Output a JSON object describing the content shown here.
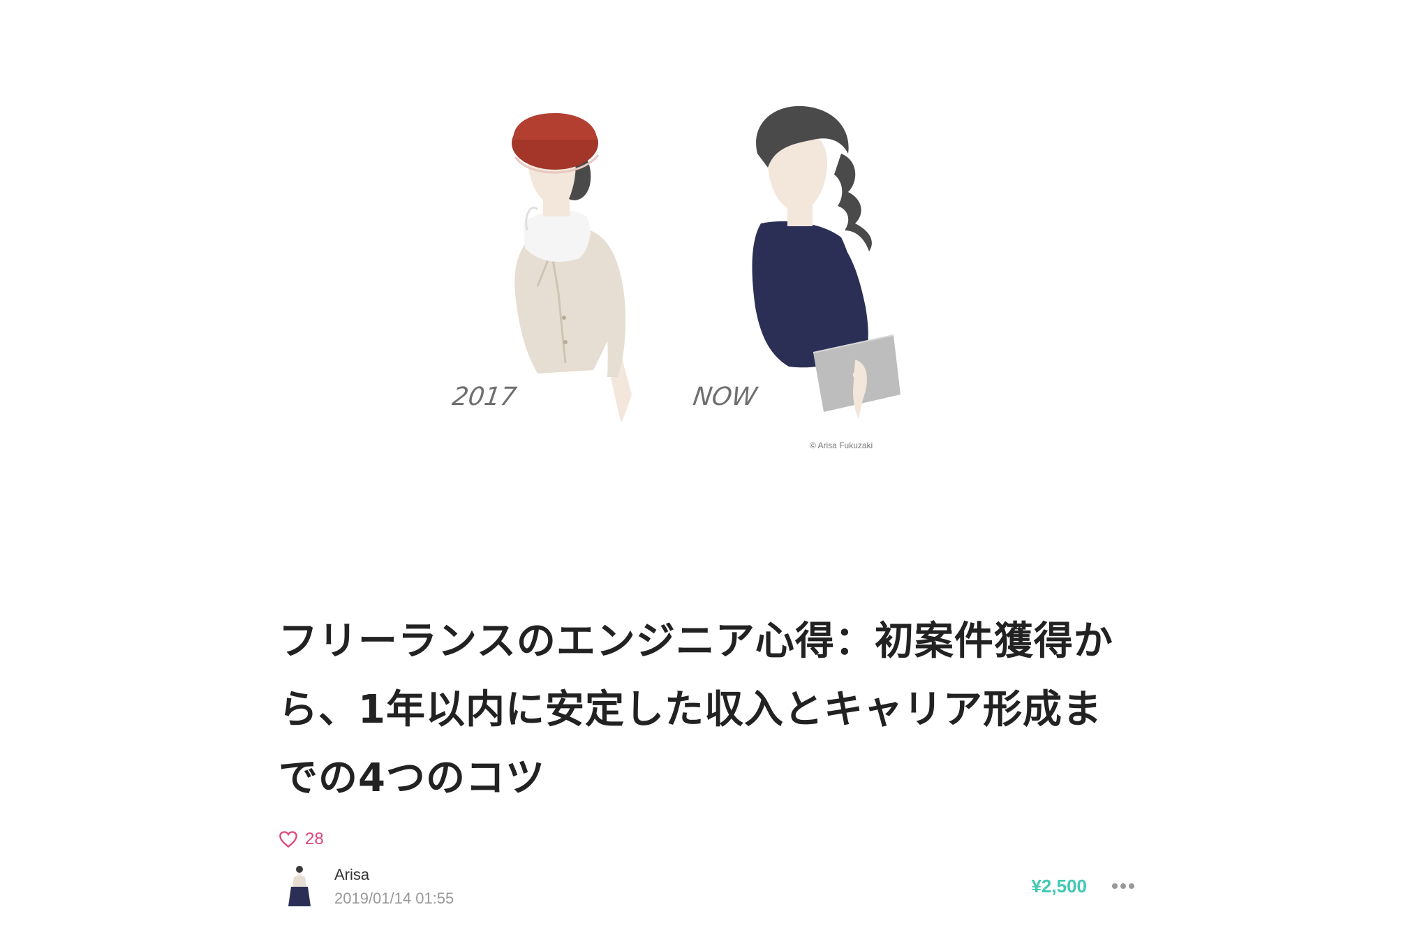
{
  "hero": {
    "label_left": "2017",
    "label_right": "NOW",
    "credit": "© Arisa Fukuzaki"
  },
  "article": {
    "title": "フリーランスのエンジニア心得：初案件獲得から、1年以内に安定した収入とキャリア形成までの4つのコツ",
    "likes": "28",
    "author": "Arisa",
    "date": "2019/01/14 01:55",
    "price": "¥2,500"
  },
  "colors": {
    "like": "#e0457b",
    "price": "#41c9b4",
    "title": "#222222",
    "meta_gray": "#999999"
  },
  "icons": [
    "heart-icon",
    "more-icon"
  ]
}
